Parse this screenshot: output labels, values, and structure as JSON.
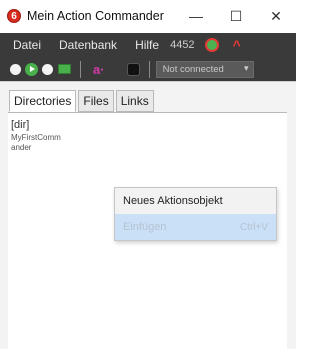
{
  "window": {
    "app_icon_glyph": "6",
    "title": "Mein Action Commander",
    "controls": {
      "minimize": "—",
      "maximize": "☐",
      "close": "✕"
    }
  },
  "menubar": {
    "items": [
      "Datei",
      "Datenbank",
      "Hilfe"
    ],
    "number": "4452",
    "icons": [
      "bug-status-icon",
      "caret-up-icon"
    ]
  },
  "toolbar": {
    "icons": [
      "record-icon",
      "play-icon",
      "stop-icon",
      "screen-icon",
      "assistant-icon",
      "database-icon"
    ],
    "assistant_glyph": "a·",
    "connection": {
      "selected": "Not connected"
    }
  },
  "tabs": [
    {
      "label": "Directories",
      "active": true
    },
    {
      "label": "Files",
      "active": false
    },
    {
      "label": "Links",
      "active": false
    }
  ],
  "directories": [
    {
      "tag": "[dir]",
      "name": "MyFirstCommander"
    }
  ],
  "context_menu": {
    "items": [
      {
        "label": "Neues Aktionsobjekt",
        "shortcut": "",
        "disabled": false
      },
      {
        "label": "Einfügen",
        "shortcut": "Ctrl+V",
        "disabled": true
      }
    ]
  },
  "colors": {
    "menubar_bg": "#3a3a3a",
    "accent_green": "#49b04b",
    "accent_red": "#e53935",
    "highlight": "#c9e0f7"
  }
}
